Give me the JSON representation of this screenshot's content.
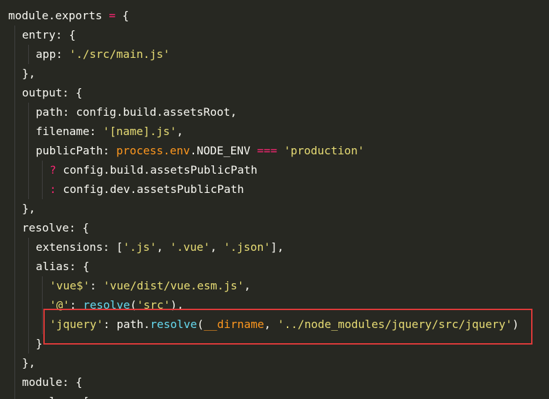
{
  "editor": {
    "lines": [
      {
        "tokens": [
          [
            "module.exports",
            "text"
          ],
          [
            " = ",
            "op"
          ],
          [
            "{",
            "punc"
          ]
        ]
      },
      {
        "indent": 1,
        "tokens": [
          [
            "entry",
            "text"
          ],
          [
            ": ",
            "punc"
          ],
          [
            "{",
            "punc"
          ]
        ]
      },
      {
        "indent": 2,
        "tokens": [
          [
            "app",
            "text"
          ],
          [
            ": ",
            "punc"
          ],
          [
            "'./src/main.js'",
            "str"
          ]
        ]
      },
      {
        "indent": 1,
        "tokens": [
          [
            "},",
            "punc"
          ]
        ]
      },
      {
        "indent": 1,
        "tokens": [
          [
            "output",
            "text"
          ],
          [
            ": ",
            "punc"
          ],
          [
            "{",
            "punc"
          ]
        ]
      },
      {
        "indent": 2,
        "tokens": [
          [
            "path",
            "text"
          ],
          [
            ": ",
            "punc"
          ],
          [
            "config.build.assetsRoot",
            "text"
          ],
          [
            ",",
            "punc"
          ]
        ]
      },
      {
        "indent": 2,
        "tokens": [
          [
            "filename",
            "text"
          ],
          [
            ": ",
            "punc"
          ],
          [
            "'[name].js'",
            "str"
          ],
          [
            ",",
            "punc"
          ]
        ]
      },
      {
        "indent": 2,
        "tokens": [
          [
            "publicPath",
            "text"
          ],
          [
            ": ",
            "punc"
          ],
          [
            "process.env",
            "var"
          ],
          [
            ".NODE_ENV ",
            "text"
          ],
          [
            "===",
            "op"
          ],
          [
            " ",
            "text"
          ],
          [
            "'production'",
            "str"
          ]
        ]
      },
      {
        "indent": 3,
        "tokens": [
          [
            "? ",
            "op"
          ],
          [
            "config.build.assetsPublicPath",
            "text"
          ]
        ]
      },
      {
        "indent": 3,
        "tokens": [
          [
            ": ",
            "op"
          ],
          [
            "config.dev.assetsPublicPath",
            "text"
          ]
        ]
      },
      {
        "indent": 1,
        "tokens": [
          [
            "},",
            "punc"
          ]
        ]
      },
      {
        "indent": 1,
        "tokens": [
          [
            "resolve",
            "text"
          ],
          [
            ": ",
            "punc"
          ],
          [
            "{",
            "punc"
          ]
        ]
      },
      {
        "indent": 2,
        "tokens": [
          [
            "extensions",
            "text"
          ],
          [
            ": ",
            "punc"
          ],
          [
            "[",
            "punc"
          ],
          [
            "'.js'",
            "str"
          ],
          [
            ", ",
            "punc"
          ],
          [
            "'.vue'",
            "str"
          ],
          [
            ", ",
            "punc"
          ],
          [
            "'.json'",
            "str"
          ],
          [
            "],",
            "punc"
          ]
        ]
      },
      {
        "indent": 2,
        "tokens": [
          [
            "alias",
            "text"
          ],
          [
            ": ",
            "punc"
          ],
          [
            "{",
            "punc"
          ]
        ]
      },
      {
        "indent": 3,
        "tokens": [
          [
            "'vue$'",
            "str"
          ],
          [
            ": ",
            "punc"
          ],
          [
            "'vue/dist/vue.esm.js'",
            "str"
          ],
          [
            ",",
            "punc"
          ]
        ]
      },
      {
        "indent": 3,
        "tokens": [
          [
            "'@'",
            "str"
          ],
          [
            ": ",
            "punc"
          ],
          [
            "resolve",
            "fn"
          ],
          [
            "(",
            "punc"
          ],
          [
            "'src'",
            "str"
          ],
          [
            "),",
            "punc"
          ]
        ]
      },
      {
        "indent": 3,
        "tokens": [
          [
            "'jquery'",
            "str"
          ],
          [
            ": ",
            "punc"
          ],
          [
            "path.",
            "text"
          ],
          [
            "resolve",
            "fn"
          ],
          [
            "(",
            "punc"
          ],
          [
            "__dirname",
            "var"
          ],
          [
            ", ",
            "punc"
          ],
          [
            "'../node_modules/jquery/src/jquery'",
            "str"
          ],
          [
            ")",
            "punc"
          ]
        ]
      },
      {
        "indent": 2,
        "tokens": [
          [
            "}",
            "punc"
          ]
        ]
      },
      {
        "indent": 1,
        "tokens": [
          [
            "},",
            "punc"
          ]
        ]
      },
      {
        "indent": 1,
        "tokens": [
          [
            "module",
            "text"
          ],
          [
            ": ",
            "punc"
          ],
          [
            "{",
            "punc"
          ]
        ]
      },
      {
        "indent": 2,
        "tokens": [
          [
            "rules",
            "text"
          ],
          [
            ": ",
            "punc"
          ],
          [
            "[",
            "punc"
          ]
        ]
      }
    ]
  },
  "highlight": {
    "color": "#e03a3a",
    "label": "jquery alias line"
  }
}
